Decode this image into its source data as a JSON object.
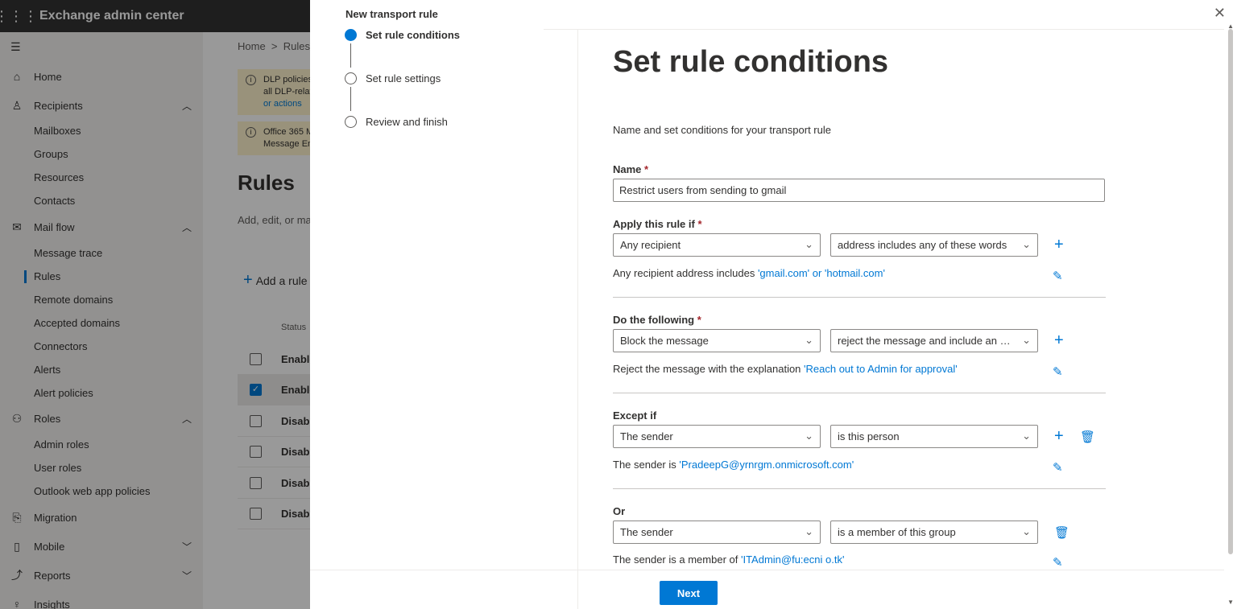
{
  "topbar": {
    "app_title": "Exchange admin center",
    "waffle_icon": "waffle-icon"
  },
  "nav": {
    "home": "Home",
    "recipients": "Recipients",
    "recipients_sub": [
      "Mailboxes",
      "Groups",
      "Resources",
      "Contacts"
    ],
    "mail_flow": "Mail flow",
    "mail_flow_sub": [
      "Message trace",
      "Rules",
      "Remote domains",
      "Accepted domains",
      "Connectors",
      "Alerts",
      "Alert policies"
    ],
    "roles": "Roles",
    "roles_sub": [
      "Admin roles",
      "User roles",
      "Outlook web app policies"
    ],
    "migration": "Migration",
    "mobile": "Mobile",
    "reports": "Reports",
    "insights": "Insights"
  },
  "bg": {
    "breadcrumb_home": "Home",
    "breadcrumb_sep": ">",
    "breadcrumb_rules": "Rules",
    "banner1_line1": "DLP policies",
    "banner1_line2": "all DLP-relat",
    "banner1_link": "or actions",
    "banner2_line1": "Office 365 M",
    "banner2_line2": "Message En",
    "title": "Rules",
    "desc": "Add, edit, or ma",
    "add_rule": "Add a rule",
    "col_status": "Status",
    "rows": [
      "Enable",
      "Enable",
      "Disabl",
      "Disabl",
      "Disabl",
      "Disabl"
    ]
  },
  "wizard": {
    "title": "New transport rule",
    "steps": [
      "Set rule conditions",
      "Set rule settings",
      "Review and finish"
    ]
  },
  "form": {
    "title": "Set rule conditions",
    "desc": "Name and set conditions for your transport rule",
    "name_label": "Name",
    "required": "*",
    "name_value": "Restrict users from sending to gmail",
    "apply_label": "Apply this rule if",
    "apply_dd1": "Any recipient",
    "apply_dd2": "address includes any of these words",
    "apply_summary_prefix": "Any recipient address includes ",
    "apply_summary_value": "'gmail.com' or 'hotmail.com'",
    "do_label": "Do the following",
    "do_dd1": "Block the message",
    "do_dd2": "reject the message and include an exp...",
    "do_summary_prefix": "Reject the message with the explanation ",
    "do_summary_value": "'Reach out to Admin for approval'",
    "except_label": "Except if",
    "except_dd1": "The sender",
    "except_dd2": "is this person",
    "except_summary_prefix": "The sender is ",
    "except_summary_value": "'PradeepG@yrnrgm.onmicrosoft.com'",
    "or_label": "Or",
    "or_dd1": "The sender",
    "or_dd2": "is a member of this group",
    "or_summary_prefix": "The sender is a member of ",
    "or_summary_value": "'ITAdmin@fu:ecni o.tk'",
    "next": "Next"
  },
  "icons": {
    "plus": "+",
    "chevron": "⌄",
    "pencil": "✎",
    "trash": "🗑",
    "close": "✕"
  },
  "colors": {
    "accent": "#0078d4",
    "topbar": "#333333",
    "required": "#a4262c"
  }
}
